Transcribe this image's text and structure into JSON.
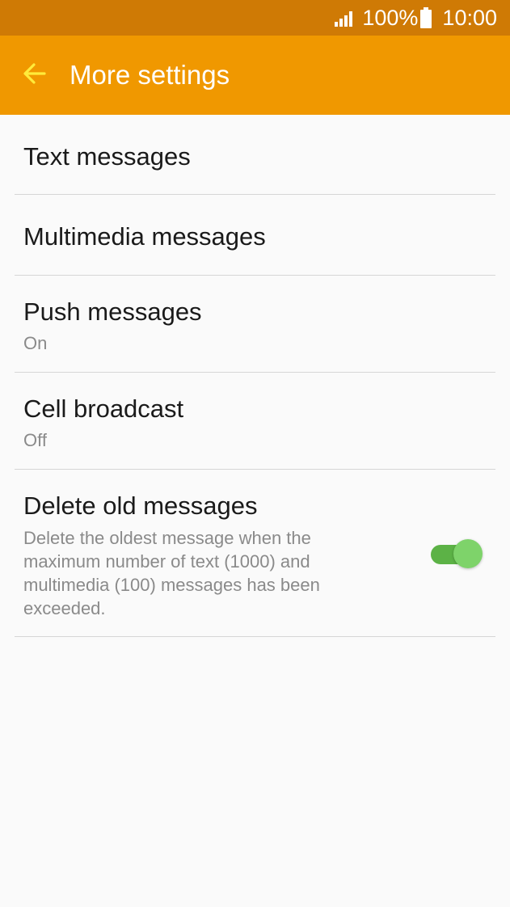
{
  "status_bar": {
    "battery_percent": "100%",
    "time": "10:00",
    "icons": [
      "signal-icon",
      "battery-icon"
    ]
  },
  "app_bar": {
    "title": "More settings",
    "back_icon": "arrow-left-icon"
  },
  "settings": [
    {
      "title": "Text messages"
    },
    {
      "title": "Multimedia messages"
    },
    {
      "title": "Push messages",
      "subtitle": "On"
    },
    {
      "title": "Cell broadcast",
      "subtitle": "Off"
    },
    {
      "title": "Delete old messages",
      "subtitle": "Delete the oldest message when the maximum number of text (1000) and multimedia (100) messages has been exceeded.",
      "toggle_on": true
    }
  ],
  "colors": {
    "status_bar": "#cf7a05",
    "app_bar": "#f09800",
    "back_arrow": "#ffeb3b",
    "toggle_track": "#5cb246",
    "toggle_knob": "#7ed36a"
  }
}
